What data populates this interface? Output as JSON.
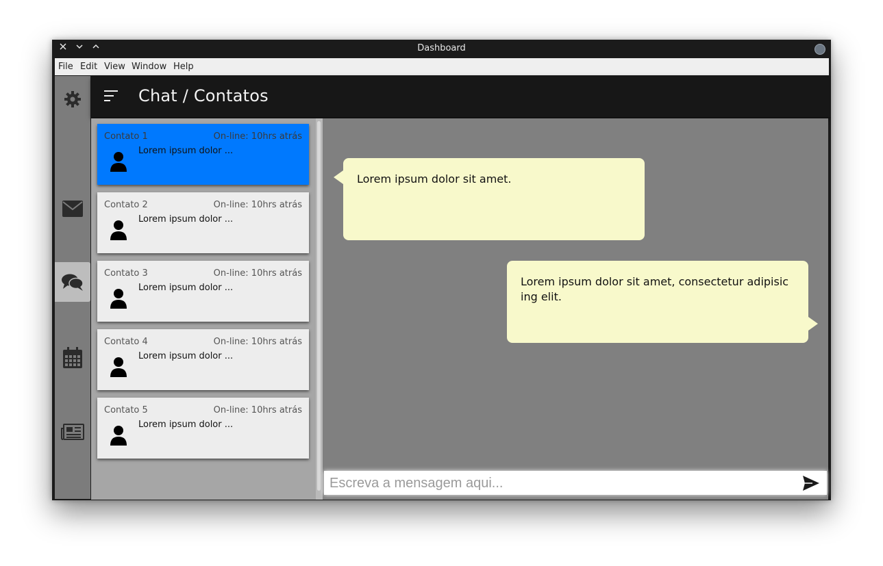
{
  "window": {
    "title": "Dashboard"
  },
  "menubar": {
    "items": [
      "File",
      "Edit",
      "View",
      "Window",
      "Help"
    ]
  },
  "sidebar": {
    "icons": [
      {
        "name": "gear-icon"
      },
      {
        "name": "envelope-icon"
      },
      {
        "name": "chat-icon",
        "active": true
      },
      {
        "name": "calendar-icon"
      },
      {
        "name": "newspaper-icon"
      }
    ]
  },
  "header": {
    "title": "Chat / Contatos"
  },
  "contacts": [
    {
      "name": "Contato 1",
      "status": "On-line: 10hrs atrás",
      "preview": "Lorem ipsum dolor ...",
      "active": true
    },
    {
      "name": "Contato 2",
      "status": "On-line: 10hrs atrás",
      "preview": "Lorem ipsum dolor ..."
    },
    {
      "name": "Contato 3",
      "status": "On-line: 10hrs atrás",
      "preview": "Lorem ipsum dolor ..."
    },
    {
      "name": "Contato 4",
      "status": "On-line: 10hrs atrás",
      "preview": "Lorem ipsum dolor ..."
    },
    {
      "name": "Contato 5",
      "status": "On-line: 10hrs atrás",
      "preview": "Lorem ipsum dolor ..."
    }
  ],
  "messages": [
    {
      "side": "left",
      "text": "Lorem ipsum dolor sit amet."
    },
    {
      "side": "right",
      "text": "Lorem ipsum dolor sit amet, consectetur adipisic ing elit."
    }
  ],
  "composer": {
    "placeholder": "Escreva a mensagem aqui..."
  },
  "colors": {
    "active_contact": "#0079fe",
    "bubble": "#f8f9cb",
    "chat_bg": "#808080"
  }
}
